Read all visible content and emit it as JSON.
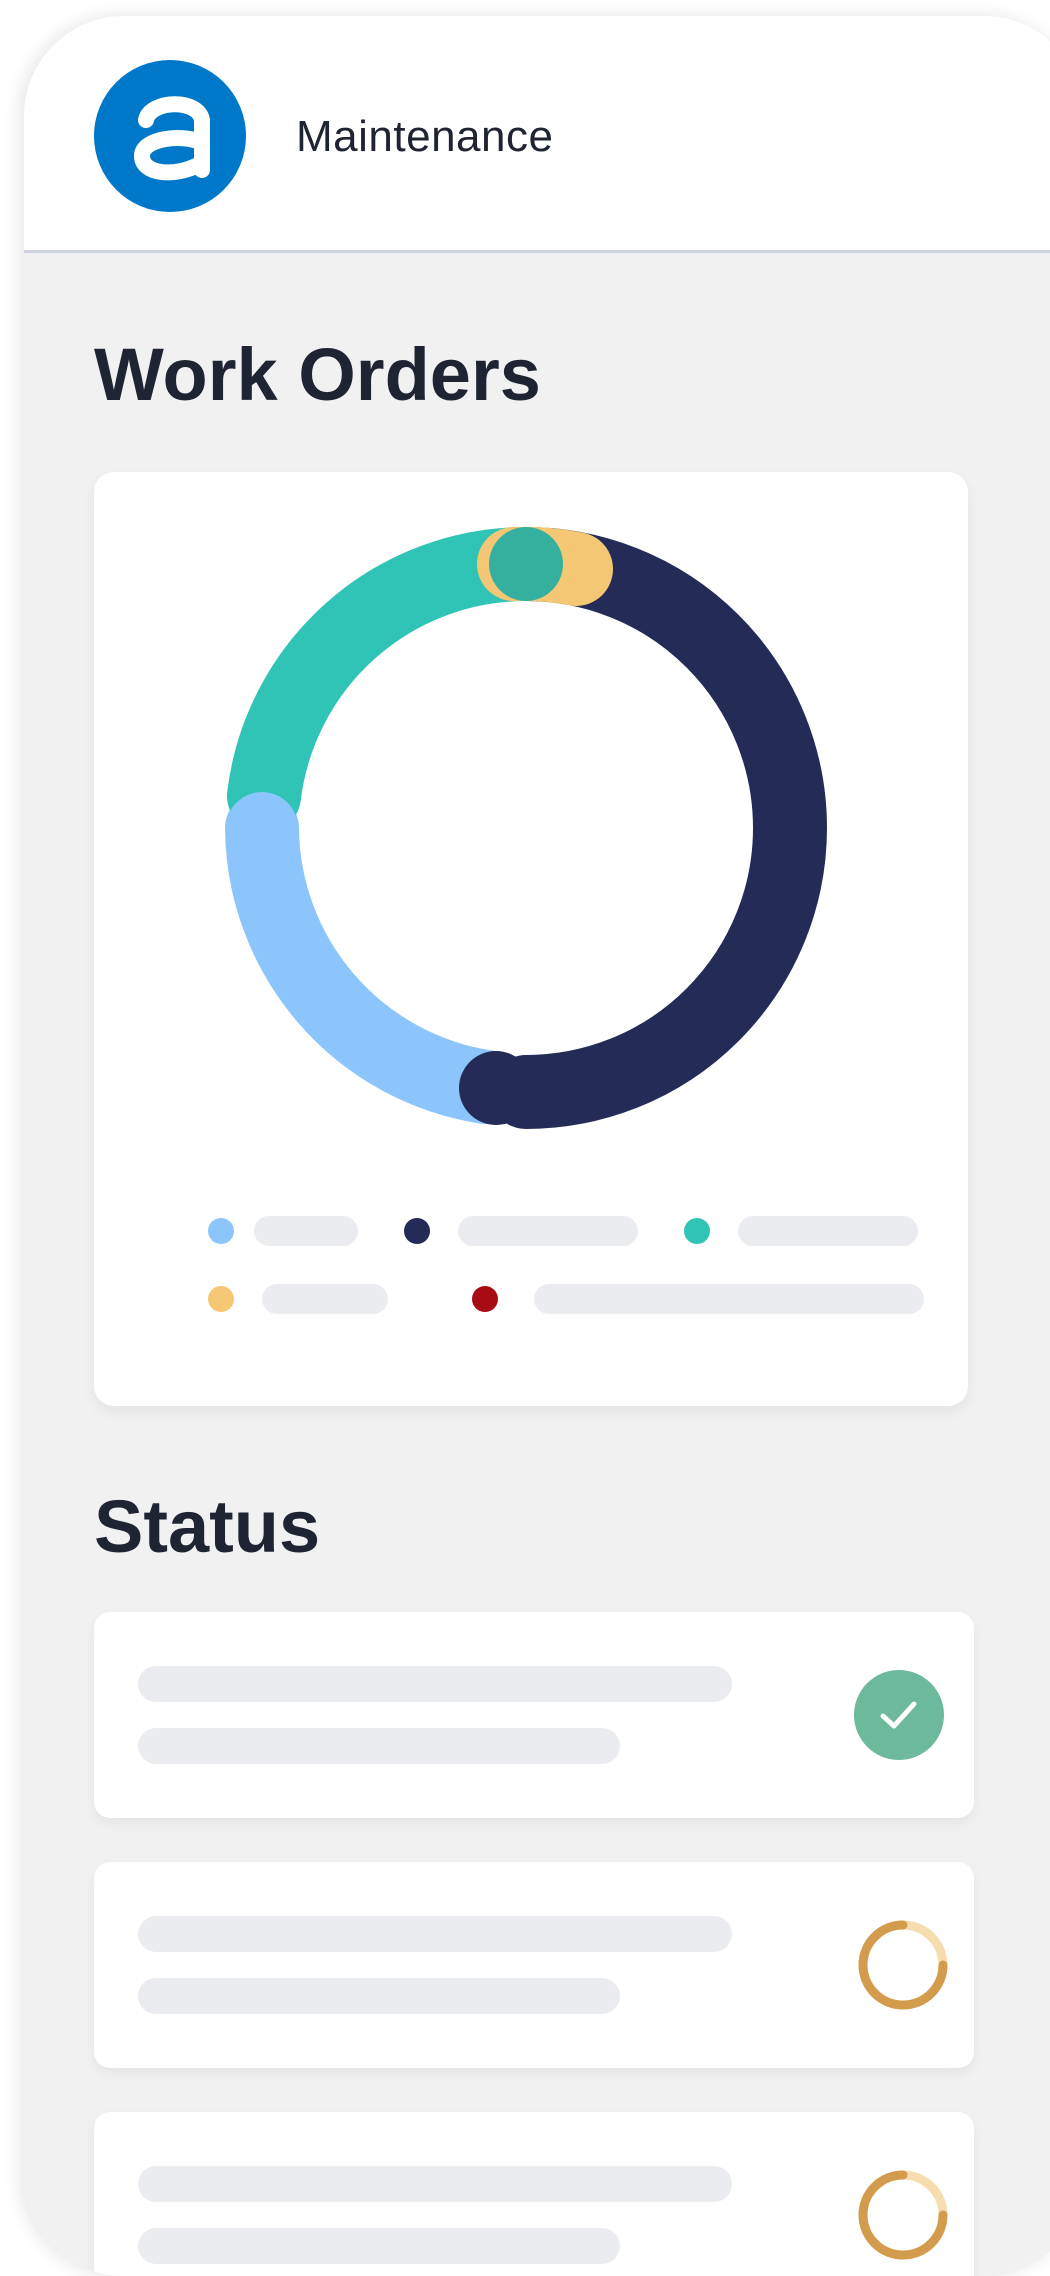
{
  "header": {
    "app_name": "Maintenance",
    "logo_icon": "app-logo-a-icon",
    "brand_color": "#0078c9"
  },
  "work_orders": {
    "title": "Work Orders"
  },
  "chart_data": {
    "type": "pie",
    "donut": true,
    "title": "",
    "slices": [
      {
        "color": "#242b57",
        "fraction": 0.5
      },
      {
        "color": "#8bc5fb",
        "fraction": 0.21
      },
      {
        "color": "#2fc4b6",
        "fraction": 0.25
      },
      {
        "color": "#f4c774",
        "fraction": 0.04
      },
      {
        "color": "#a80b13",
        "fraction": 0.0
      }
    ],
    "legend": {
      "placement": "bottom",
      "colors": [
        "#8bc5fb",
        "#242b57",
        "#2fc4b6",
        "#f4c774",
        "#a80b13"
      ]
    }
  },
  "status": {
    "title": "Status",
    "items": [
      {
        "state": "complete",
        "icon": "check-circle-icon",
        "color": "#6cb99c"
      },
      {
        "state": "in-progress",
        "icon": "progress-ring-icon",
        "color": "#d39b4c",
        "progress": 0.2
      },
      {
        "state": "in-progress",
        "icon": "progress-ring-icon",
        "color": "#d39b4c",
        "progress": 0.2
      }
    ]
  }
}
